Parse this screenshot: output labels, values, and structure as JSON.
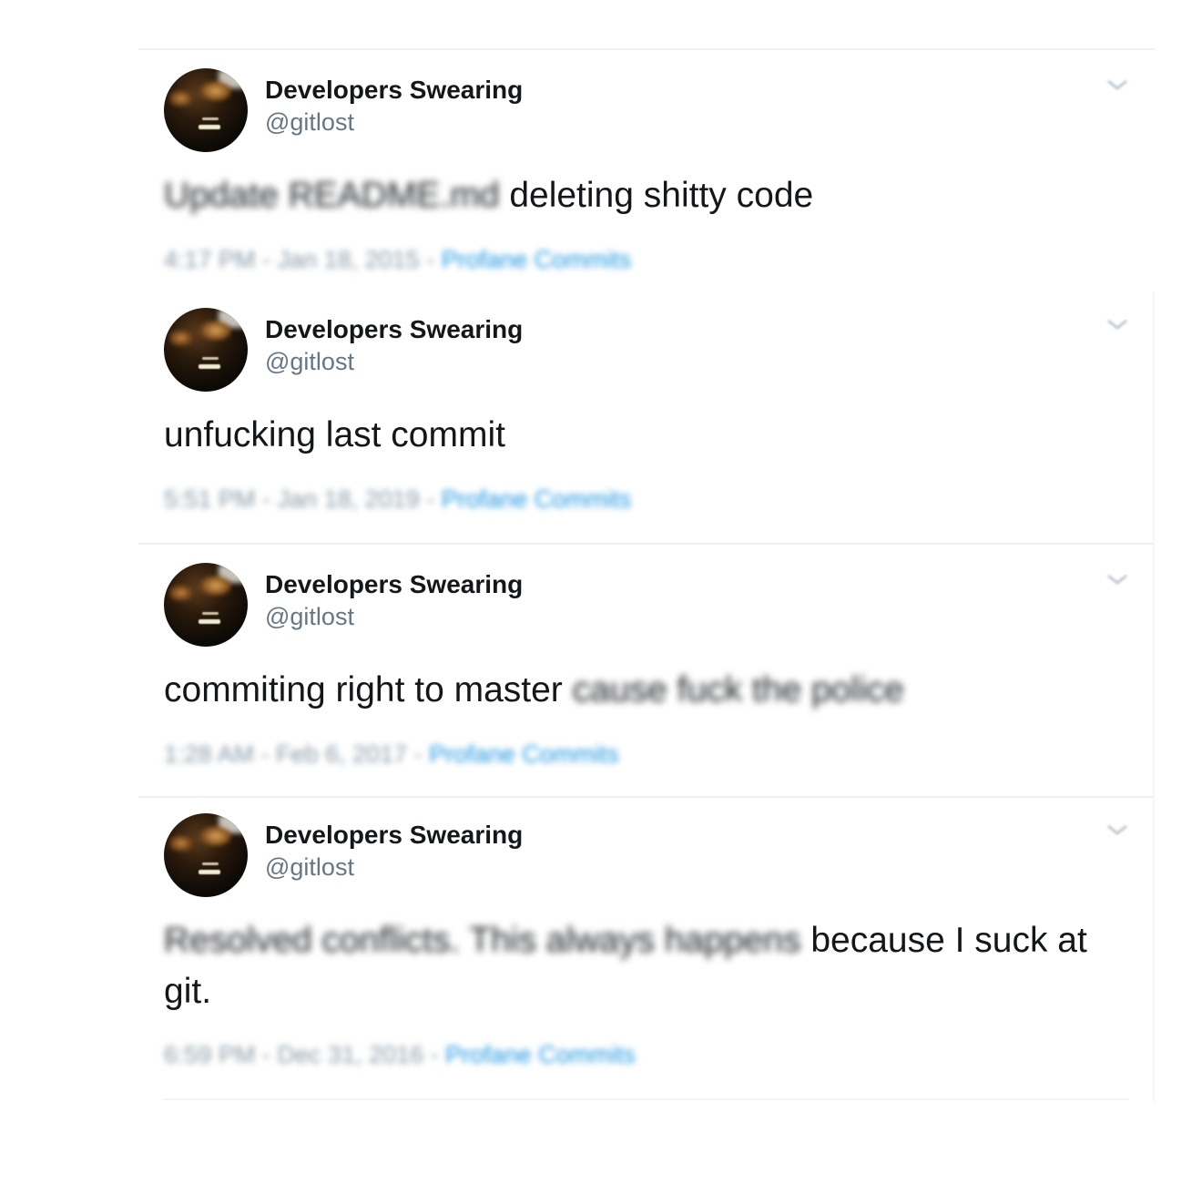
{
  "tweets": [
    {
      "name": "Developers Swearing",
      "handle": "@gitlost",
      "text_blurred": "Update README.md",
      "text": "deleting shitty code",
      "text_blurred_after": "",
      "time": "4:17 PM - Jan 18, 2015",
      "source": "Profane Commits",
      "sep": " - "
    },
    {
      "name": "Developers Swearing",
      "handle": "@gitlost",
      "text_blurred": "",
      "text": "unfucking last commit",
      "text_blurred_after": "",
      "time": "5:51 PM - Jan 18, 2019",
      "source": "Profane Commits",
      "sep": " - "
    },
    {
      "name": "Developers Swearing",
      "handle": "@gitlost",
      "text_blurred": "",
      "text": "commiting right to master",
      "text_blurred_after": "cause fuck the police",
      "time": "1:28 AM - Feb 6, 2017",
      "source": "Profane Commits",
      "sep": " - "
    },
    {
      "name": "Developers Swearing",
      "handle": "@gitlost",
      "text_blurred": "Resolved conflicts. This always happens",
      "text": "because I suck at git.",
      "text_blurred_after": "",
      "time": "6:59 PM - Dec 31, 2016",
      "source": "Profane Commits",
      "sep": " - "
    }
  ],
  "icons": {
    "avatar": "avatar-photo",
    "menu": "chevron-down-icon"
  },
  "colors": {
    "name": "#14171a",
    "handle": "#657786",
    "meta": "#8899a6",
    "link": "#1b95e0",
    "separator": "#eef0f2"
  }
}
